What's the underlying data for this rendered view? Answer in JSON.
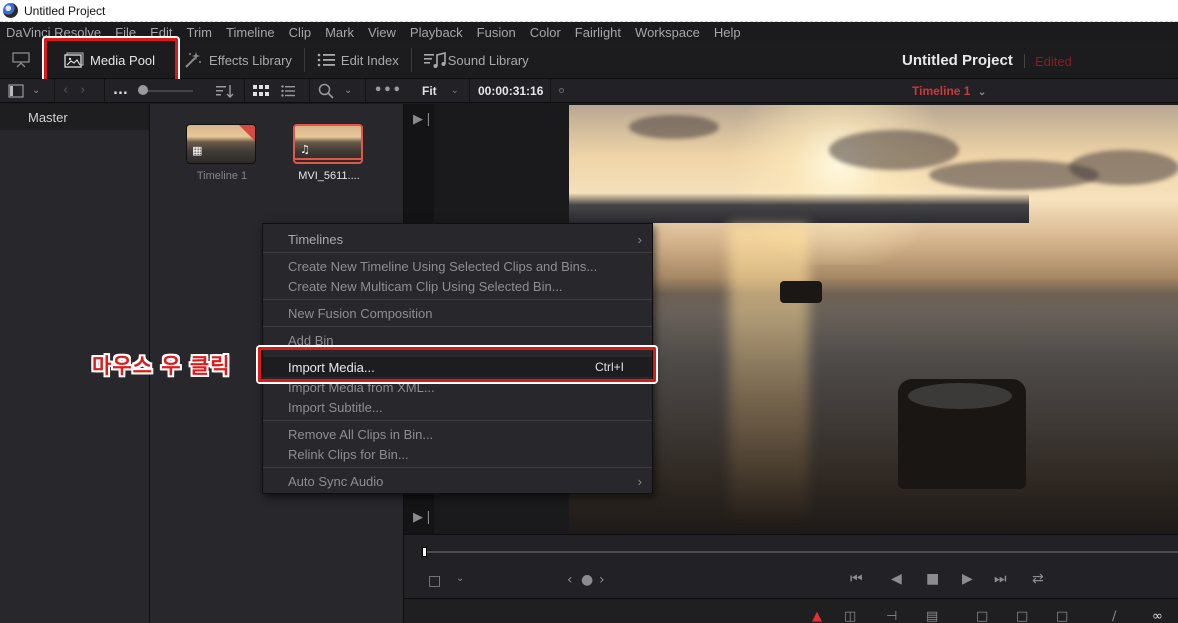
{
  "window": {
    "title": "Untitled Project"
  },
  "menu": [
    "DaVinci Resolve",
    "File",
    "Edit",
    "Trim",
    "Timeline",
    "Clip",
    "Mark",
    "View",
    "Playback",
    "Fusion",
    "Color",
    "Fairlight",
    "Workspace",
    "Help"
  ],
  "toolbar": {
    "media_pool": "Media Pool",
    "effects_library": "Effects Library",
    "edit_index": "Edit Index",
    "sound_library": "Sound Library"
  },
  "project": {
    "title": "Untitled Project",
    "status": "Edited",
    "status_color": "#8e1c1c"
  },
  "media_pool_bar": {
    "path": "...",
    "zoom_level": 0.0
  },
  "viewer": {
    "fit": "Fit",
    "timecode": "00:00:31:16",
    "timeline_name": "Timeline 1",
    "playhead_position": 0.0
  },
  "bins": {
    "master": "Master"
  },
  "clips": [
    {
      "name": "Timeline 1",
      "type": "timeline",
      "selected": false
    },
    {
      "name": "MVI_5611....",
      "type": "audio-video",
      "selected": true
    }
  ],
  "context_menu": {
    "items": [
      {
        "label": "Timelines",
        "submenu": true
      },
      {
        "label": "Create New Timeline Using Selected Clips and Bins..."
      },
      {
        "label": "Create New Multicam Clip Using Selected Bin..."
      },
      {
        "label": "New Fusion Composition"
      },
      {
        "label": "Add Bin"
      },
      {
        "label": "Import Media...",
        "shortcut": "Ctrl+I",
        "highlighted": true
      },
      {
        "label": "Import Media from XML..."
      },
      {
        "label": "Import Subtitle..."
      },
      {
        "label": "Remove All Clips in Bin..."
      },
      {
        "label": "Relink Clips for Bin..."
      },
      {
        "label": "Auto Sync Audio",
        "submenu": true
      }
    ]
  },
  "annotation": {
    "text": "마우스 우 클릭",
    "color": "#e01b1b"
  },
  "colors": {
    "highlight_box": "#d91a1a",
    "accent": "#e0574a",
    "timeline_name": "#c73a3a"
  }
}
